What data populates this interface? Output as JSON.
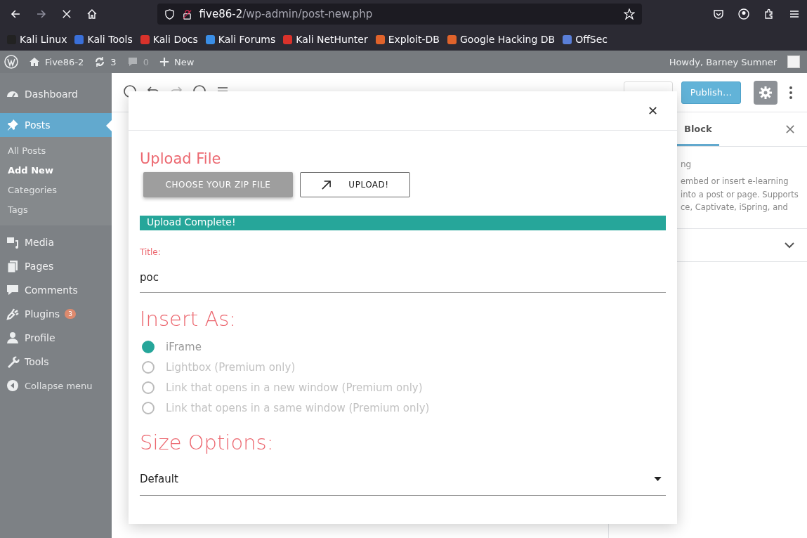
{
  "browser": {
    "url": {
      "host": "five86-2",
      "path": "/wp-admin/post-new.php"
    },
    "bookmarks": [
      {
        "label": "Kali Linux",
        "color": "#222222"
      },
      {
        "label": "Kali Tools",
        "color": "#3a6fd8"
      },
      {
        "label": "Kali Docs",
        "color": "#d9322b"
      },
      {
        "label": "Kali Forums",
        "color": "#3a8ee6"
      },
      {
        "label": "Kali NetHunter",
        "color": "#d9322b"
      },
      {
        "label": "Exploit-DB",
        "color": "#e0632b"
      },
      {
        "label": "Google Hacking DB",
        "color": "#e0632b"
      },
      {
        "label": "OffSec",
        "color": "#5a7fd8"
      }
    ]
  },
  "admin_bar": {
    "site": "Five86-2",
    "updates": "3",
    "comments": "0",
    "new": "New",
    "greeting": "Howdy, Barney Sumner"
  },
  "sidebar": {
    "items": [
      {
        "label": "Dashboard",
        "selected": false
      },
      {
        "label": "Posts",
        "selected": true,
        "children": [
          {
            "label": "All Posts",
            "selected": false
          },
          {
            "label": "Add New",
            "selected": true
          },
          {
            "label": "Categories",
            "selected": false
          },
          {
            "label": "Tags",
            "selected": false
          }
        ]
      },
      {
        "label": "Media",
        "selected": false
      },
      {
        "label": "Pages",
        "selected": false
      },
      {
        "label": "Comments",
        "selected": false
      },
      {
        "label": "Plugins",
        "selected": false,
        "badge": "3"
      },
      {
        "label": "Profile",
        "selected": false
      },
      {
        "label": "Tools",
        "selected": false
      },
      {
        "label": "Collapse menu",
        "selected": false
      }
    ]
  },
  "editor": {
    "publish": "Publish…",
    "sidebar_tab": "Block",
    "block_description": [
      "ng",
      "embed or insert e-learning",
      "into a post or page. Supports",
      "ce, Captivate, iSpring, and"
    ]
  },
  "modal": {
    "heading": "Upload File",
    "choose_button": "CHOOSE YOUR ZIP FILE",
    "upload_button": "UPLOAD!",
    "status": "Upload Complete!",
    "title_label": "Title:",
    "title_value": "poc",
    "insert_heading": "Insert As:",
    "options": [
      {
        "label": "iFrame",
        "selected": true,
        "disabled": false
      },
      {
        "label": "Lightbox (Premium only)",
        "selected": false,
        "disabled": true
      },
      {
        "label": "Link that opens in a new window (Premium only)",
        "selected": false,
        "disabled": true
      },
      {
        "label": "Link that opens in a same window (Premium only)",
        "selected": false,
        "disabled": true
      }
    ],
    "size_heading": "Size Options:",
    "size_value": "Default"
  }
}
